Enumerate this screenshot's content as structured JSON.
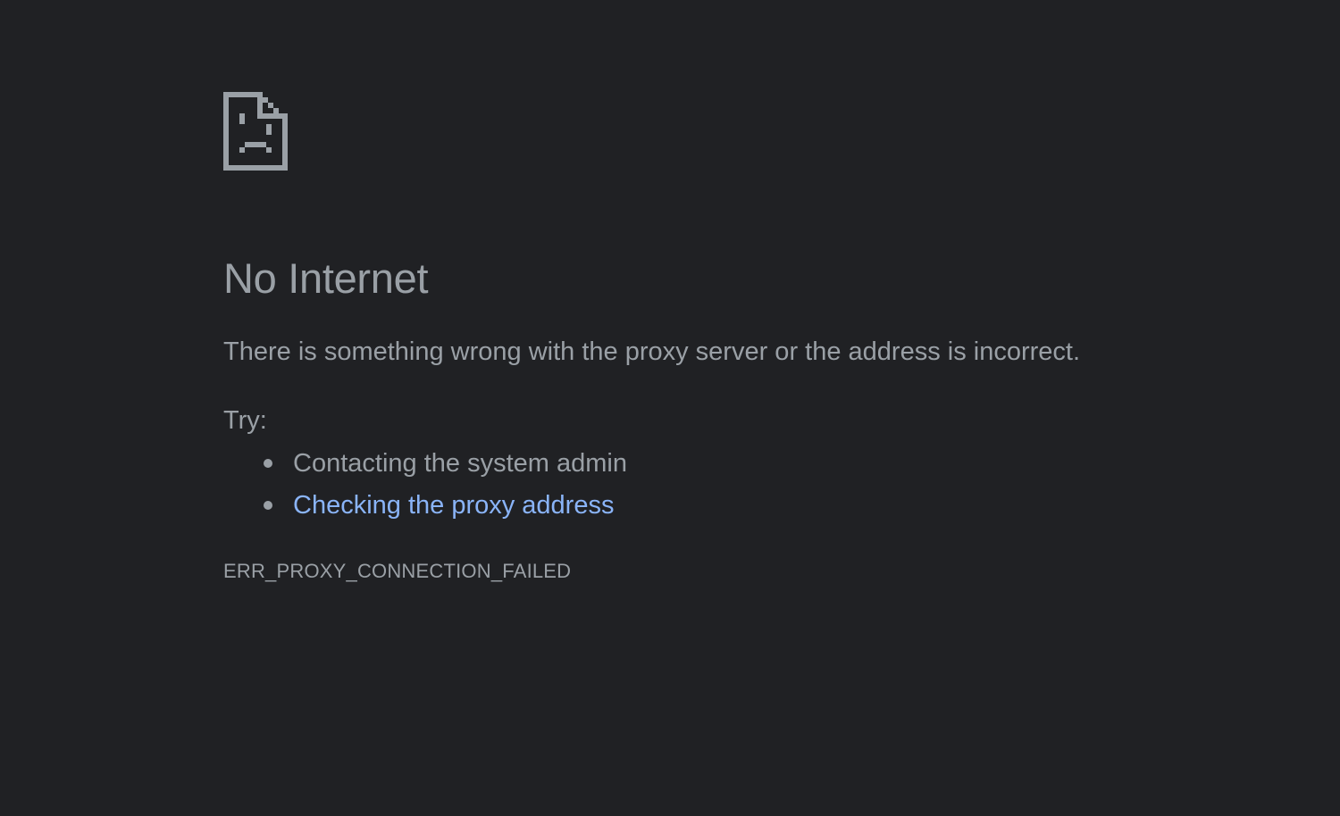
{
  "page": {
    "background_color": "#202124",
    "text_color": "#9aa0a6",
    "link_color": "#8ab4f8"
  },
  "icon": {
    "name": "sad-document-icon"
  },
  "error": {
    "title": "No Internet",
    "description": "There is something wrong with the proxy server or the address is incorrect.",
    "try_label": "Try:",
    "suggestions": [
      {
        "text": "Contacting the system admin",
        "is_link": false
      },
      {
        "text": "Checking the proxy address",
        "is_link": true
      }
    ],
    "code": "ERR_PROXY_CONNECTION_FAILED"
  }
}
